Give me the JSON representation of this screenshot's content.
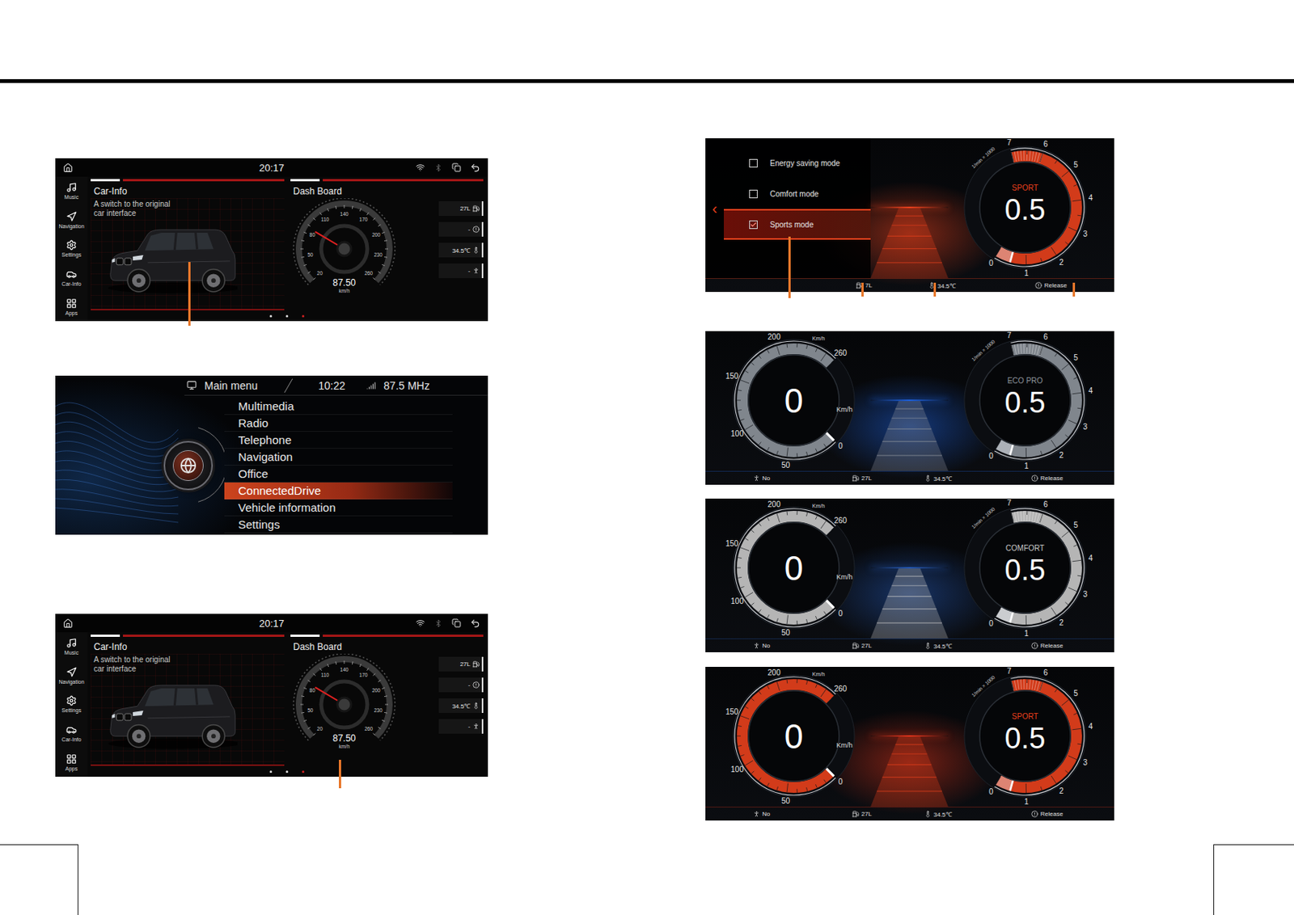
{
  "car_info_screens": [
    {
      "status_bar": {
        "time": "20:17"
      },
      "sidebar": {
        "items": [
          {
            "label": "Music"
          },
          {
            "label": "Navigation"
          },
          {
            "label": "Settings"
          },
          {
            "label": "Car-Info"
          },
          {
            "label": "Apps"
          }
        ]
      },
      "car_card": {
        "title": "Car-Info",
        "description": "A switch to the original car interface"
      },
      "dash_card": {
        "title": "Dash Board",
        "gauge": {
          "ticks": [
            "20",
            "50",
            "80",
            "110",
            "140",
            "170",
            "200",
            "230",
            "260"
          ],
          "speed": "87.50",
          "unit": "km/h",
          "level": 0.28
        },
        "readings": [
          {
            "value": "27L"
          },
          {
            "value": "-"
          },
          {
            "value": "34.5℃"
          },
          {
            "value": "-"
          }
        ]
      },
      "page_dots": [
        {
          "selected": false
        },
        {
          "selected": false
        },
        {
          "selected": true
        }
      ]
    },
    {
      "status_bar": {
        "time": "20:17"
      },
      "sidebar": {
        "items": [
          {
            "label": "Music"
          },
          {
            "label": "Navigation"
          },
          {
            "label": "Settings"
          },
          {
            "label": "Car-Info"
          },
          {
            "label": "Apps"
          }
        ]
      },
      "car_card": {
        "title": "Car-Info",
        "description": "A switch to the original car interface"
      },
      "dash_card": {
        "title": "Dash Board",
        "gauge": {
          "ticks": [
            "20",
            "50",
            "80",
            "110",
            "140",
            "170",
            "200",
            "230",
            "260"
          ],
          "speed": "87.50",
          "unit": "km/h",
          "level": 0.28
        },
        "readings": [
          {
            "value": "27L"
          },
          {
            "value": "-"
          },
          {
            "value": "34.5℃"
          },
          {
            "value": "-"
          }
        ]
      },
      "page_dots": [
        {
          "selected": false
        },
        {
          "selected": false
        },
        {
          "selected": true
        }
      ]
    }
  ],
  "main_menu": {
    "title": "Main menu",
    "time": "10:22",
    "frequency": "87.5 MHz",
    "items": [
      {
        "label": "Multimedia",
        "selected": false
      },
      {
        "label": "Radio",
        "selected": false
      },
      {
        "label": "Telephone",
        "selected": false
      },
      {
        "label": "Navigation",
        "selected": false
      },
      {
        "label": "Office",
        "selected": false
      },
      {
        "label": "ConnectedDrive",
        "selected": true
      },
      {
        "label": "Vehicle information",
        "selected": false
      },
      {
        "label": "Settings",
        "selected": false
      }
    ]
  },
  "mode_screen": {
    "back": "‹",
    "modes": [
      {
        "label": "Energy saving mode",
        "checked": false,
        "selected": false
      },
      {
        "label": "Comfort mode",
        "checked": false,
        "selected": false
      },
      {
        "label": "Sports mode",
        "checked": true,
        "selected": true
      }
    ],
    "rpm": {
      "mode": "SPORT",
      "value": "0.5",
      "unit": "1/min × 1000",
      "ticks": [
        "0",
        "1",
        "2",
        "3",
        "4",
        "5",
        "6",
        "7"
      ],
      "level": 0.07
    },
    "status": {
      "fuel": "7L",
      "temperature": "34.5℃",
      "parking_brake": "Release"
    }
  },
  "dashboards": [
    {
      "mode": "ECO PRO",
      "color": "#8d939b",
      "glow": "#1d5ed6",
      "speed": {
        "value": "0",
        "unit": "Km/h",
        "scale_unit": "Km/h",
        "ticks": [
          "0",
          "50",
          "100",
          "150",
          "200",
          "260"
        ],
        "level": 0
      },
      "rpm": {
        "value": "0.5",
        "unit": "1/min × 1000",
        "ticks": [
          "0",
          "1",
          "2",
          "3",
          "4",
          "5",
          "6",
          "7"
        ],
        "level": 0.07
      },
      "status": {
        "seatbelt": "No",
        "fuel": "27L",
        "temperature": "34.5℃",
        "parking_brake": "Release"
      }
    },
    {
      "mode": "COMFORT",
      "color": "#c8c8c8",
      "glow": "#2456b0",
      "speed": {
        "value": "0",
        "unit": "Km/h",
        "scale_unit": "Km/h",
        "ticks": [
          "0",
          "50",
          "100",
          "150",
          "200",
          "260"
        ],
        "level": 0
      },
      "rpm": {
        "value": "0.5",
        "unit": "1/min × 1000",
        "ticks": [
          "0",
          "1",
          "2",
          "3",
          "4",
          "5",
          "6",
          "7"
        ],
        "level": 0.07
      },
      "status": {
        "seatbelt": "No",
        "fuel": "27L",
        "temperature": "34.5℃",
        "parking_brake": "Release"
      }
    },
    {
      "mode": "SPORT",
      "color": "#e8401c",
      "glow": "#d8321a",
      "speed": {
        "value": "0",
        "unit": "Km/h",
        "scale_unit": "Km/h",
        "ticks": [
          "0",
          "50",
          "100",
          "150",
          "200",
          "260"
        ],
        "level": 0
      },
      "rpm": {
        "value": "0.5",
        "unit": "1/min × 1000",
        "ticks": [
          "0",
          "1",
          "2",
          "3",
          "4",
          "5",
          "6",
          "7"
        ],
        "level": 0.07
      },
      "status": {
        "seatbelt": "No",
        "fuel": "27L",
        "temperature": "34.5℃",
        "parking_brake": "Release"
      }
    }
  ]
}
